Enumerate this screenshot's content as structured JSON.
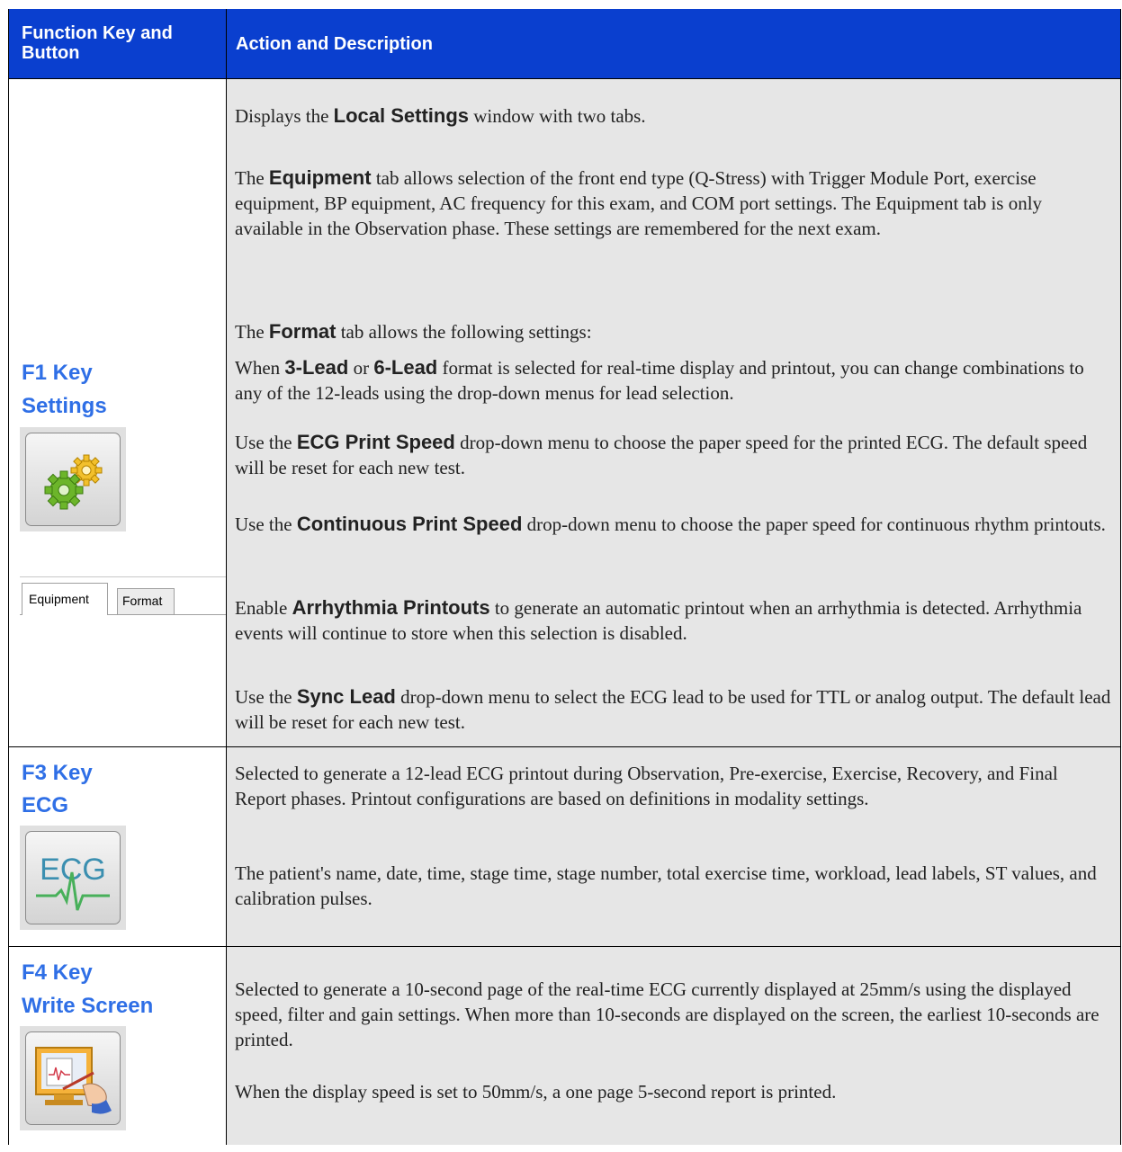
{
  "header": {
    "col1": "Function Key and Button",
    "col2": "Action and Description"
  },
  "rows": [
    {
      "key_line1": "F1 Key",
      "key_line2": "Settings",
      "icon": "settings-gears-icon",
      "tabs": [
        "Equipment",
        "Format"
      ],
      "paragraphs": [
        {
          "pre": "Displays the ",
          "bold": "Local Settings",
          "post": " window with two tabs."
        },
        {
          "pre": "The ",
          "bold": "Equipment",
          "post": " tab allows selection of the front end type (Q-Stress) with Trigger Module Port, exercise equipment, BP equipment, AC frequency for this exam, and COM port settings.  The Equipment tab is only available in the Observation phase.  These settings are remembered for the next exam."
        },
        {
          "pre": "The ",
          "bold": "Format",
          "post": " tab allows the following settings:"
        },
        {
          "pre": "When ",
          "bold": "3-Lead",
          "mid": " or ",
          "bold2": "6-Lead",
          "post": " format is selected for real-time display and printout, you can change combinations to any of the 12-leads using the drop-down menus for lead selection."
        },
        {
          "pre": "Use the ",
          "bold": "ECG Print Speed",
          "post": " drop-down menu to choose the paper speed for the printed ECG.  The default speed will be reset for each new test."
        },
        {
          "pre": "Use the ",
          "bold": "Continuous Print Speed",
          "post": " drop-down menu to choose the paper speed for continuous rhythm printouts."
        },
        {
          "pre": "Enable ",
          "bold": "Arrhythmia Printouts",
          "post": " to generate an automatic printout when an arrhythmia is detected.  Arrhythmia events will continue to store when this selection is disabled."
        },
        {
          "pre": "Use the ",
          "bold": "Sync Lead",
          "post": " drop-down menu to select the ECG lead to be used for TTL or analog output.  The default lead will be reset for each new test."
        }
      ]
    },
    {
      "key_line1": "F3 Key",
      "key_line2": "ECG",
      "icon": "ecg-icon",
      "icon_text": "ECG",
      "paragraphs": [
        "Selected to generate a 12-lead ECG printout during Observation, Pre-exercise, Exercise, Recovery, and Final Report phases.  Printout configurations are based on definitions in modality settings.",
        "The patient's name, date, time, stage time, stage number, total exercise time, workload, lead labels, ST values, and calibration pulses."
      ]
    },
    {
      "key_line1": "F4 Key",
      "key_line2": "Write Screen",
      "icon": "write-screen-icon",
      "paragraphs": [
        "Selected to generate a 10-second page of the real-time ECG currently displayed at 25mm/s using the displayed speed, filter and gain settings.  When more than 10-seconds are displayed on the screen, the earliest 10-seconds are printed.",
        "When the display speed is set to 50mm/s, a one page 5-second report is printed."
      ]
    }
  ]
}
